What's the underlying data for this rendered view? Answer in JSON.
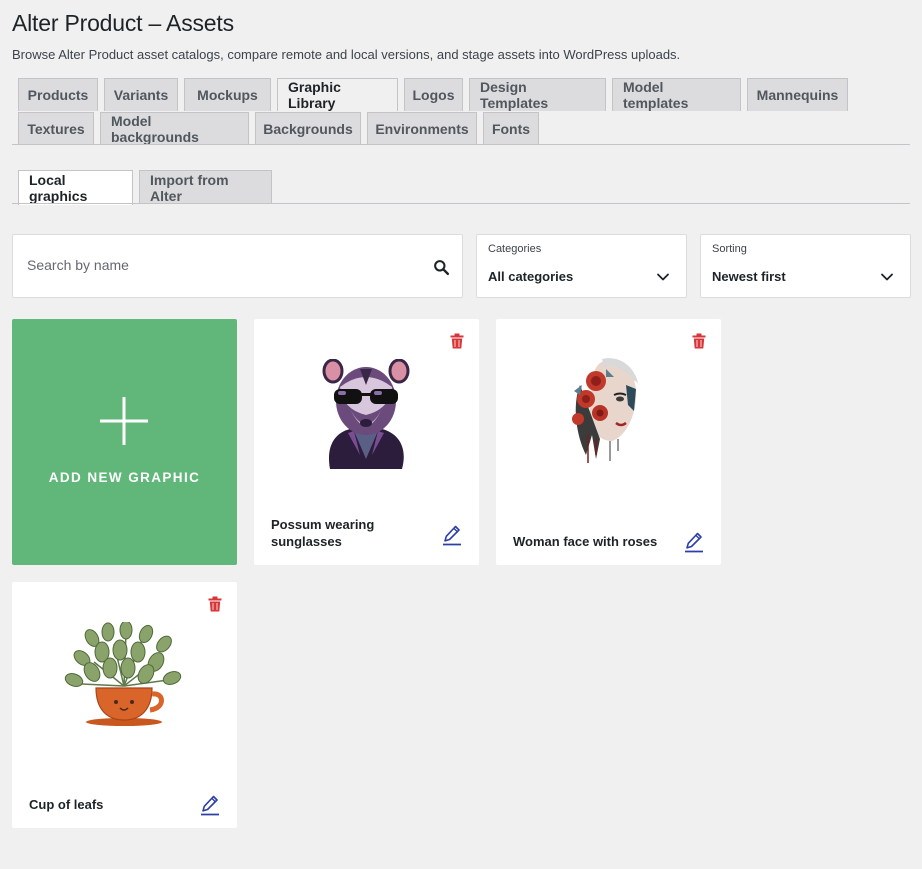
{
  "header": {
    "title": "Alter Product – Assets",
    "description": "Browse Alter Product asset catalogs, compare remote and local versions, and stage assets into WordPress uploads."
  },
  "nav_tabs": {
    "row1": [
      "Products",
      "Variants",
      "Mockups",
      "Graphic Library",
      "Logos",
      "Design Templates",
      "Model templates",
      "Mannequins"
    ],
    "row2": [
      "Textures",
      "Model backgrounds",
      "Backgrounds",
      "Environments",
      "Fonts"
    ],
    "active": "Graphic Library"
  },
  "sub_tabs": {
    "items": [
      "Local graphics",
      "Import from Alter"
    ],
    "active": "Local graphics"
  },
  "filters": {
    "search_placeholder": "Search by name",
    "categories": {
      "label": "Categories",
      "value": "All categories"
    },
    "sorting": {
      "label": "Sorting",
      "value": "Newest first"
    }
  },
  "add_card": {
    "label": "ADD NEW GRAPHIC"
  },
  "graphics": [
    {
      "title_line1": "Possum wearing",
      "title_line2": "sunglasses",
      "image": "possum-sunglasses-illustration"
    },
    {
      "title_line1": "Woman face with roses",
      "title_line2": "",
      "image": "woman-face-roses-illustration"
    },
    {
      "title_line1": "Cup of leafs",
      "title_line2": "",
      "image": "potted-plant-cup-illustration"
    }
  ],
  "colors": {
    "add_card_bg": "#61b77a",
    "delete_icon": "#d63638",
    "edit_icon": "#2c3fa8",
    "page_bg": "#f0f0f1"
  }
}
